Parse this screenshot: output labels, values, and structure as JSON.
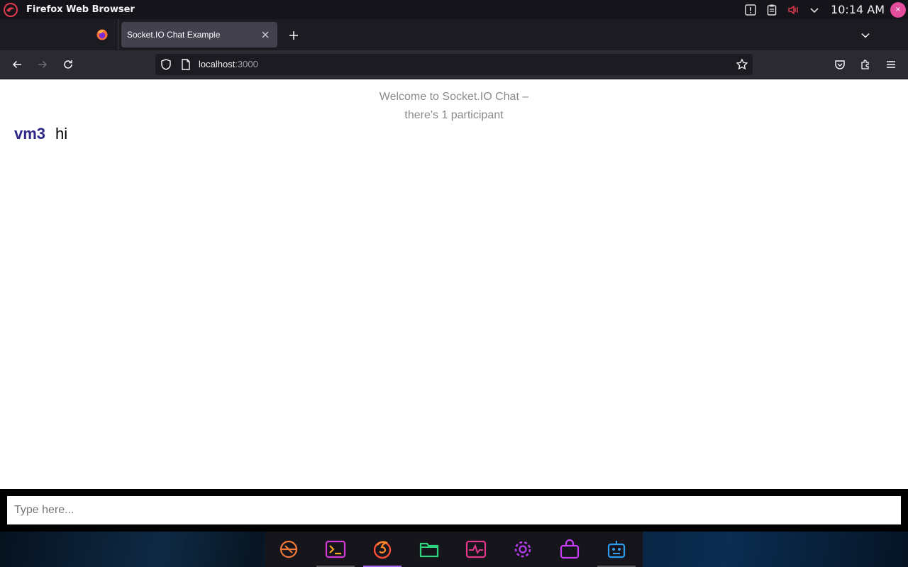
{
  "system_bar": {
    "app_title": "Firefox Web Browser",
    "clock": "10:14 AM"
  },
  "tabs": [
    {
      "title": "Socket.IO Chat Example",
      "active": true
    }
  ],
  "urlbar": {
    "host": "localhost",
    "port": ":3000"
  },
  "page": {
    "welcome_line1": "Welcome to Socket.IO Chat –",
    "welcome_line2": "there's 1 participant",
    "messages": [
      {
        "username": "vm3",
        "text": "hi"
      }
    ],
    "input_placeholder": "Type here..."
  },
  "colors": {
    "username": "#2f2889",
    "log_text": "#8a8a8a",
    "dock_active_indicator": "#a56cf0"
  },
  "dock": {
    "items": [
      {
        "icon": "app-launcher-icon",
        "active": false
      },
      {
        "icon": "terminal-icon",
        "active": false
      },
      {
        "icon": "firefox-icon",
        "active": true
      },
      {
        "icon": "files-icon",
        "active": false
      },
      {
        "icon": "system-monitor-icon",
        "active": false
      },
      {
        "icon": "settings-icon",
        "active": false
      },
      {
        "icon": "software-store-icon",
        "active": false
      },
      {
        "icon": "robot-app-icon",
        "active": false
      }
    ]
  }
}
